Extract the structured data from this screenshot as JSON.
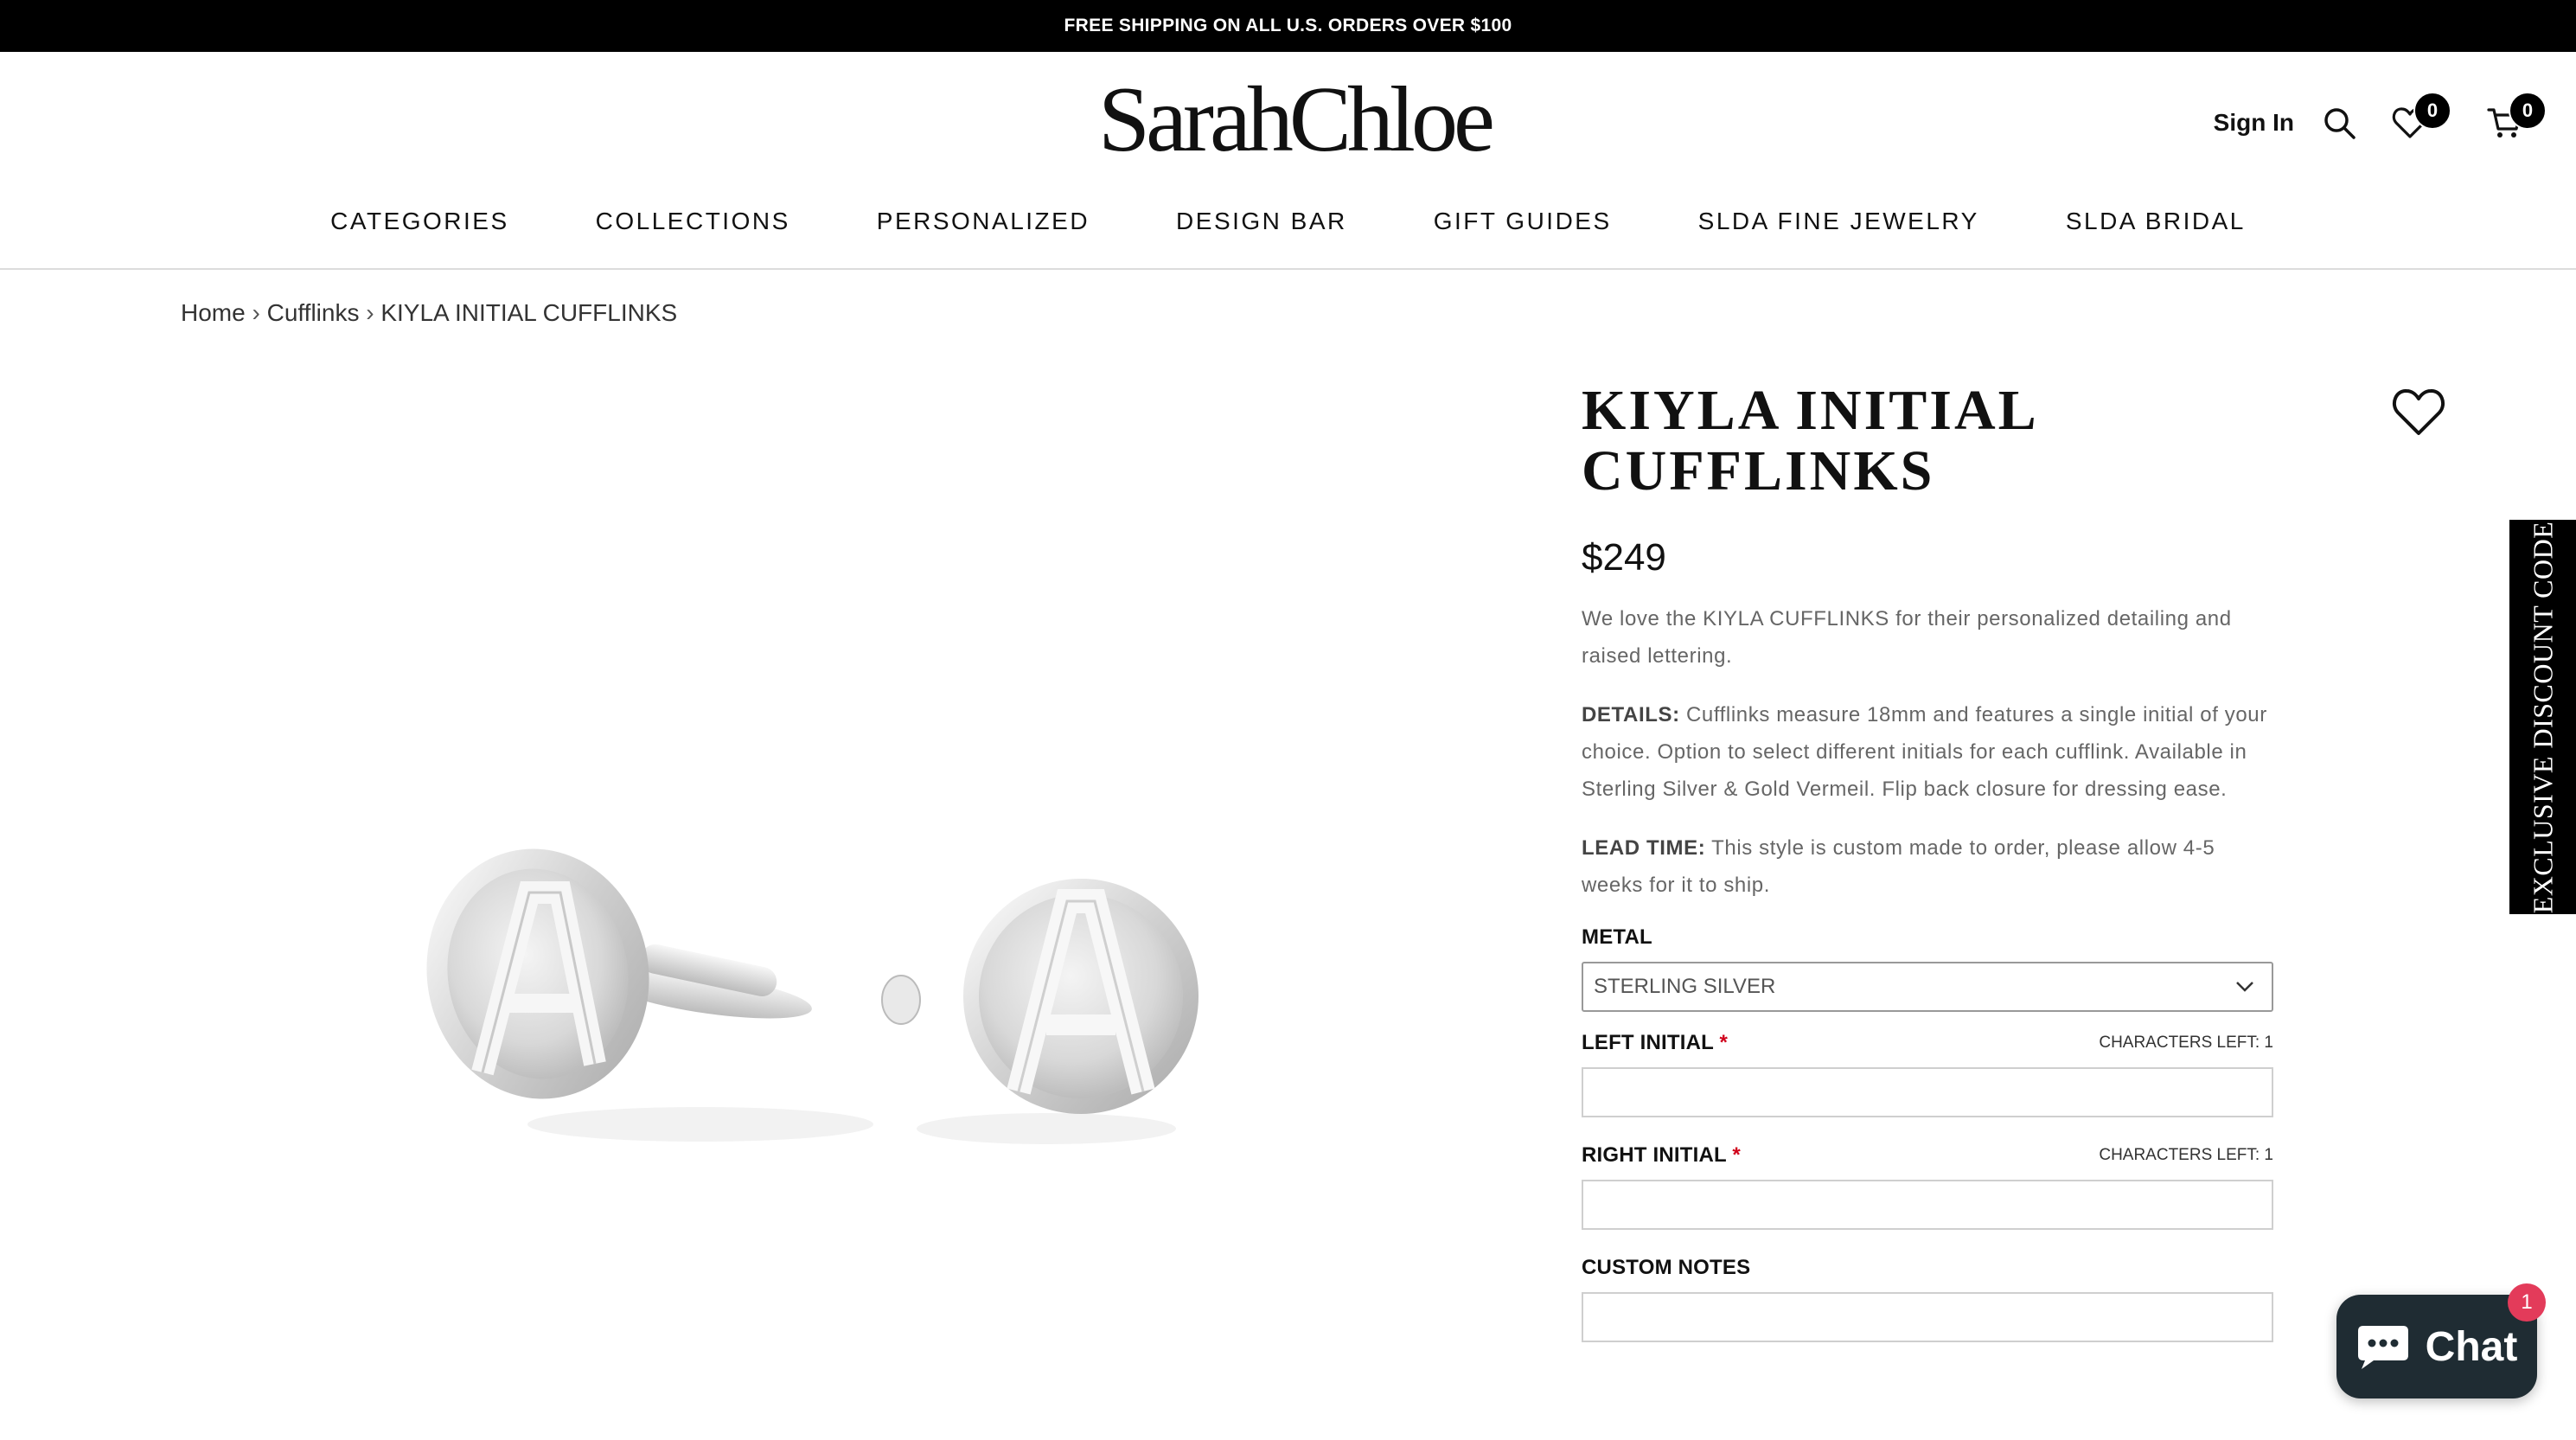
{
  "announcement": "FREE SHIPPING ON ALL U.S. ORDERS OVER $100",
  "logo": "SarahChloe",
  "header": {
    "signin": "Sign In",
    "wishlist_count": "0",
    "cart_count": "0",
    "icons": [
      "search-icon",
      "heart-icon",
      "cart-icon"
    ]
  },
  "nav": [
    "CATEGORIES",
    "COLLECTIONS",
    "PERSONALIZED",
    "DESIGN BAR",
    "GIFT GUIDES",
    "SLDA FINE JEWELRY",
    "SLDA BRIDAL"
  ],
  "breadcrumb": [
    "Home",
    "Cufflinks",
    "KIYLA INITIAL CUFFLINKS"
  ],
  "gallery": {
    "initials": [
      "A",
      "A"
    ]
  },
  "product": {
    "title_line1": "KIYLA INITIAL",
    "title_line2": "CUFFLINKS",
    "price": "$249",
    "intro": "We love the KIYLA CUFFLINKS for their personalized detailing and raised lettering.",
    "details_label": "DETAILS:",
    "details_text": " Cufflinks measure 18mm and features a single initial of your choice. Option to select different initials for each cufflink. Available in Sterling Silver & Gold Vermeil. Flip back closure for dressing ease.",
    "lead_label": "LEAD TIME:",
    "lead_text": "  This style is custom made to order, please allow 4-5 weeks for it to ship.",
    "metal_label": "METAL",
    "metal_value": "STERLING SILVER",
    "left_initial_label": "LEFT INITIAL",
    "right_initial_label": "RIGHT INITIAL",
    "required_mark": "*",
    "chars_left": "CHARACTERS LEFT: 1",
    "custom_notes_label": "CUSTOM NOTES"
  },
  "discount_tab": "EXCLUSIVE DISCOUNT CODE",
  "chat": {
    "label": "Chat",
    "badge": "1"
  },
  "colors": {
    "accent": "#000000",
    "chat_bg": "#1f2c33",
    "chat_badge": "#e33b5a",
    "required": "#d0021b"
  }
}
